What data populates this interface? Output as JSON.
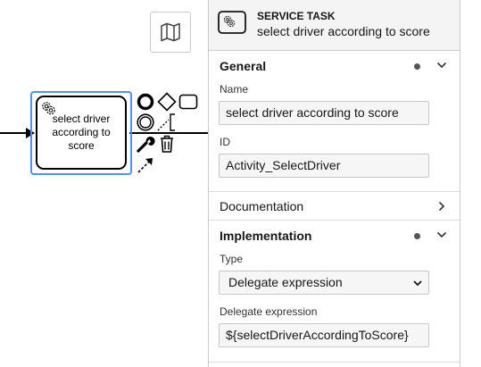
{
  "canvas": {
    "task_label": "select driver according to score"
  },
  "panel": {
    "header": {
      "type": "SERVICE TASK",
      "name": "select driver according to score"
    },
    "general": {
      "title": "General",
      "name_label": "Name",
      "name_value": "select driver according to score",
      "id_label": "ID",
      "id_value": "Activity_SelectDriver"
    },
    "documentation": {
      "title": "Documentation"
    },
    "implementation": {
      "title": "Implementation",
      "type_label": "Type",
      "type_value": "Delegate expression",
      "delegate_label": "Delegate expression",
      "delegate_value": "${selectDriverAccordingToScore}"
    }
  }
}
